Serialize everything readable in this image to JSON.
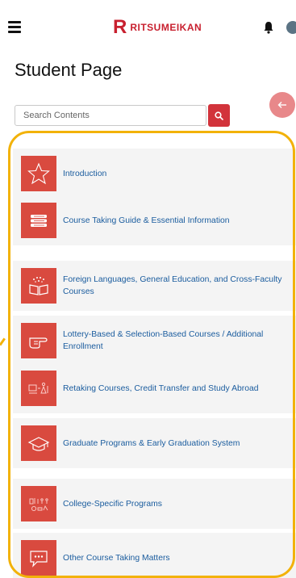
{
  "header": {
    "brand_letter": "R",
    "brand_name": "RITSUMEIKAN",
    "icons": {
      "menu": "hamburger-menu-icon",
      "bell": "bell-icon",
      "avatar": "user-avatar-icon"
    }
  },
  "page": {
    "title": "Student Page"
  },
  "search": {
    "placeholder": "Search Contents",
    "value": "",
    "button_icon": "search-icon"
  },
  "back_button": {
    "icon": "arrow-left-icon"
  },
  "colors": {
    "brand_red": "#c8202f",
    "tile_red": "#d94a3f",
    "link_blue": "#1a5c9e",
    "highlight_yellow": "#f2b20a"
  },
  "menu_items": [
    {
      "label": "Introduction",
      "icon": "star-icon"
    },
    {
      "label": "Course Taking Guide & Essential Information",
      "icon": "books-stack-icon"
    },
    {
      "label": "Foreign Languages, General Education, and Cross-Faculty Courses",
      "icon": "open-book-icon"
    },
    {
      "label": "Lottery-Based & Selection-Based Courses / Additional Enrollment",
      "icon": "pointing-hand-icon"
    },
    {
      "label": "Retaking Courses, Credit Transfer and Study Abroad",
      "icon": "transfer-icon"
    },
    {
      "label": "Graduate Programs & Early Graduation System",
      "icon": "graduation-cap-icon"
    },
    {
      "label": "College-Specific Programs",
      "icon": "college-programs-icon"
    },
    {
      "label": "Other Course Taking Matters",
      "icon": "speech-bubble-icon"
    }
  ]
}
